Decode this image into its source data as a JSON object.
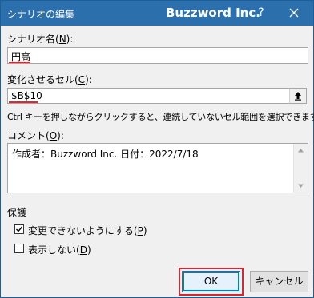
{
  "window": {
    "title": "シナリオの編集",
    "brand": "Buzzword Inc.",
    "help": "?",
    "close_icon": "close-icon"
  },
  "scenario_name": {
    "label": "シナリオ名(",
    "accel": "N",
    "label_tail": "):",
    "value": "円高"
  },
  "changing_cells": {
    "label": "変化させるセル(",
    "accel": "C",
    "label_tail": "):",
    "value": "$B$10",
    "collapse_icon": "collapse-dialog-icon"
  },
  "hint": "Ctrl キーを押しながらクリックすると、連続していないセル範囲を選択できます。",
  "comment": {
    "label": "コメント(",
    "accel": "O",
    "label_tail": "):",
    "value": "作成者：Buzzword Inc. 日付：2022/7/18"
  },
  "protection": {
    "heading": "保護",
    "prevent_changes": {
      "label": "変更できないようにする(",
      "accel": "P",
      "label_tail": ")",
      "checked": true
    },
    "hide": {
      "label": "表示しない(",
      "accel": "D",
      "label_tail": ")",
      "checked": false
    }
  },
  "buttons": {
    "ok": "OK",
    "cancel": "キャンセル"
  },
  "colors": {
    "titlebar": "#2b6fad",
    "highlight": "#d9252f",
    "accent": "#0078d7"
  }
}
